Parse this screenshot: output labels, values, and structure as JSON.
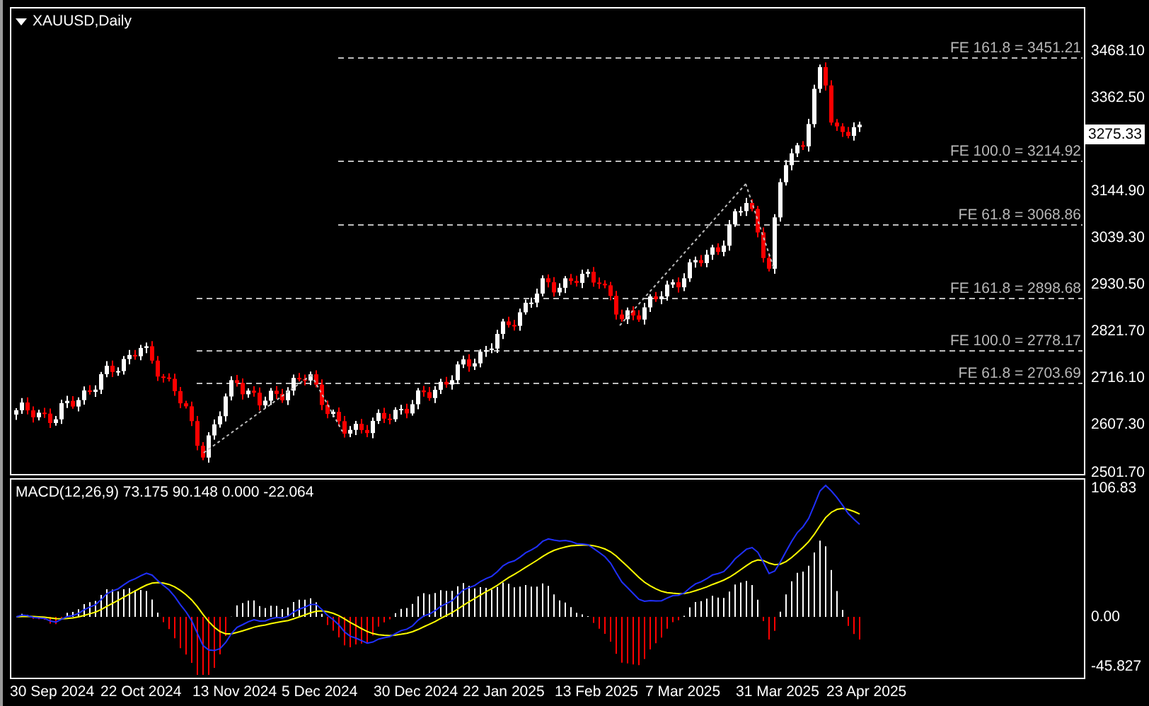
{
  "chart": {
    "title": "XAUUSD,Daily",
    "price_axis": [
      "3468.10",
      "3362.50",
      "3144.90",
      "3039.30",
      "2930.50",
      "2821.70",
      "2716.10",
      "2607.30",
      "2501.70"
    ],
    "current_price": "3275.33",
    "fib_levels": [
      {
        "label": "FE 161.8 = 3451.21"
      },
      {
        "label": "FE 100.0 = 3214.92"
      },
      {
        "label": "FE 61.8 = 3068.86"
      },
      {
        "label": "FE 161.8 = 2898.68"
      },
      {
        "label": "FE 100.0 = 2778.17"
      },
      {
        "label": "FE 61.8 = 2703.69"
      }
    ]
  },
  "macd": {
    "title": "MACD(12,26,9) 73.175 90.148 0.000 -22.064",
    "axis": [
      "106.83",
      "0.00",
      "-45.827"
    ]
  },
  "time_axis": [
    "30 Sep 2024",
    "22 Oct 2024",
    "13 Nov 2024",
    "5 Dec 2024",
    "30 Dec 2024",
    "22 Jan 2025",
    "13 Feb 2025",
    "7 Mar 2025",
    "31 Mar 2025",
    "23 Apr 2025"
  ]
}
